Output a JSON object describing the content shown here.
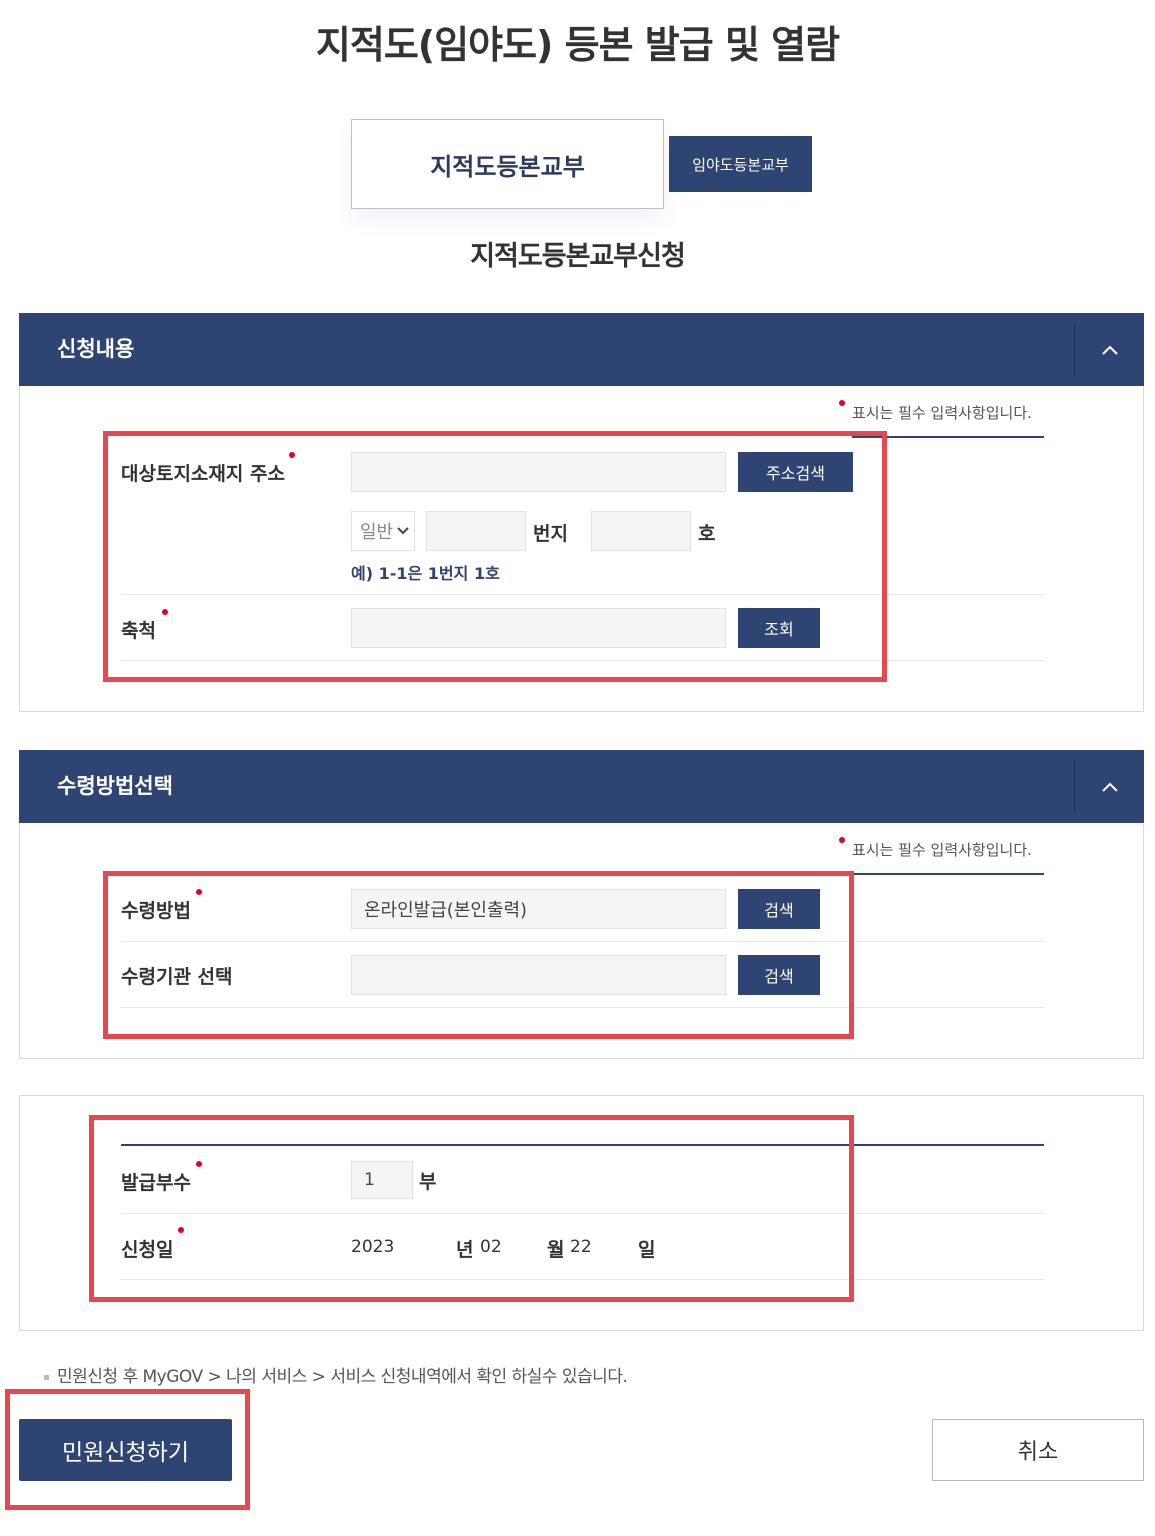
{
  "page_title": "지적도(임야도) 등본 발급 및 열람",
  "tabs": [
    {
      "label": "지적도등본교부",
      "active": true
    },
    {
      "label": "임야도등본교부",
      "active": false
    }
  ],
  "sub_title": "지적도등본교부신청",
  "required_note": "표시는 필수 입력사항입니다.",
  "section1": {
    "title": "신청내용",
    "address_label": "대상토지소재지 주소",
    "address_value": "",
    "address_search_button": "주소검색",
    "lot_type_select": "일반",
    "lot_main_value": "",
    "lot_main_unit": "번지",
    "lot_sub_value": "",
    "lot_sub_unit": "호",
    "example": "예) 1-1은 1번지 1호",
    "scale_label": "축척",
    "scale_value": "",
    "scale_button": "조회"
  },
  "section2": {
    "title": "수령방법선택",
    "method_label": "수령방법",
    "method_value": "온라인발급(본인출력)",
    "method_button": "검색",
    "agency_label": "수령기관 선택",
    "agency_value": "",
    "agency_button": "검색"
  },
  "section3": {
    "copies_label": "발급부수",
    "copies_value": "1",
    "copies_unit": "부",
    "date_label": "신청일",
    "year": "2023",
    "year_unit": "년",
    "month": "02",
    "month_unit": "월",
    "day": "22",
    "day_unit": "일"
  },
  "footer_note": "민원신청 후 MyGOV > 나의 서비스 > 서비스 신청내역에서 확인 하실수 있습니다.",
  "buttons": {
    "submit": "민원신청하기",
    "cancel": "취소"
  },
  "colors": {
    "navy": "#2e4472",
    "required_dot": "#e4002b",
    "highlight_frame": "#e8474f"
  }
}
